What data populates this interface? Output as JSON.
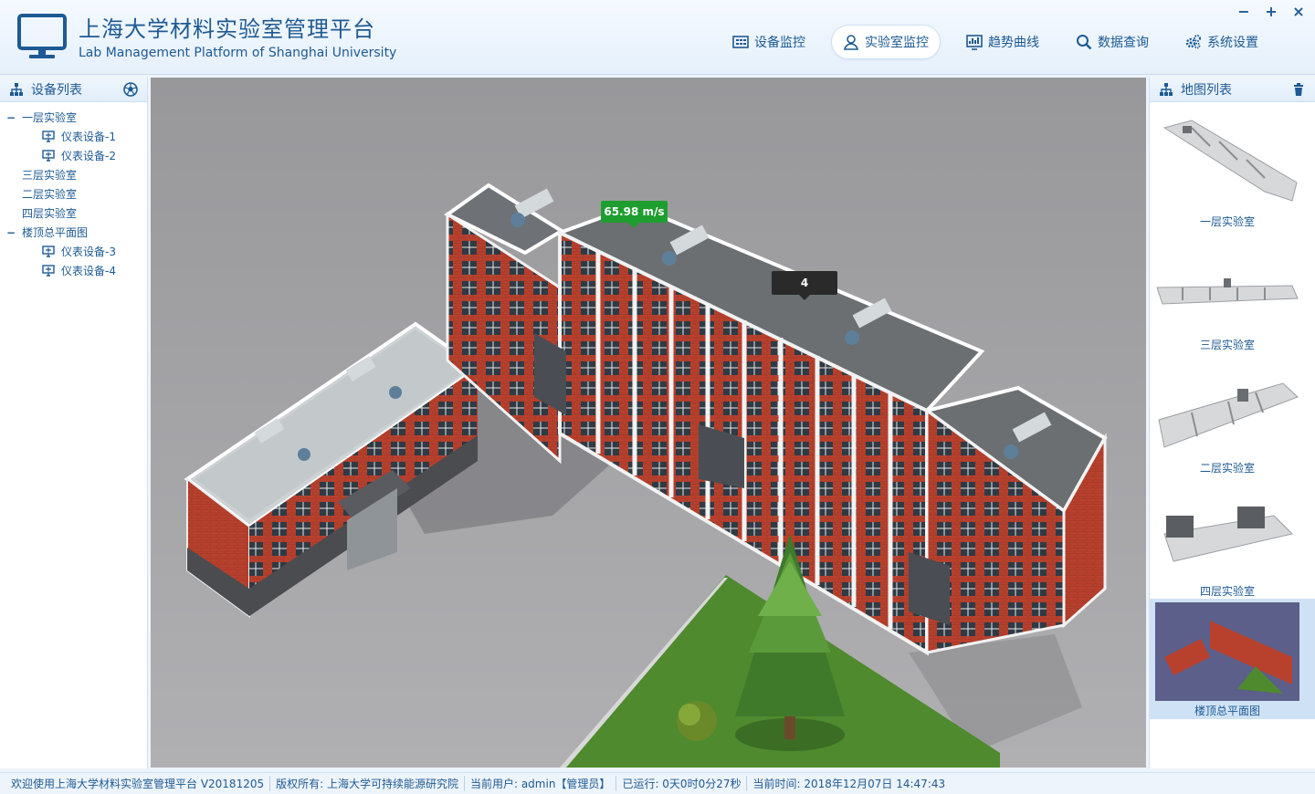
{
  "header": {
    "title": "上海大学材料实验室管理平台",
    "subtitle": "Lab Management Platform of Shanghai University",
    "logo_icon": "monitor-icon"
  },
  "nav": [
    {
      "label": "设备监控",
      "icon": "grid-icon",
      "active": false
    },
    {
      "label": "实验室监控",
      "icon": "user-location-icon",
      "active": true
    },
    {
      "label": "趋势曲线",
      "icon": "chart-icon",
      "active": false
    },
    {
      "label": "数据查询",
      "icon": "search-icon",
      "active": false
    },
    {
      "label": "系统设置",
      "icon": "gears-icon",
      "active": false
    }
  ],
  "window_controls": {
    "minimize": "−",
    "maximize": "+",
    "close": "×"
  },
  "left_panel": {
    "title": "设备列表",
    "tree": [
      {
        "label": "一层实验室",
        "toggle": "−",
        "children": [
          "仪表设备-1",
          "仪表设备-2"
        ]
      },
      {
        "label": "三层实验室"
      },
      {
        "label": "二层实验室"
      },
      {
        "label": "四层实验室"
      },
      {
        "label": "楼顶总平面图",
        "toggle": "−",
        "children": [
          "仪表设备-3",
          "仪表设备-4"
        ]
      }
    ]
  },
  "viewport": {
    "tag_speed": "65.98 m/s",
    "tag_num": "4",
    "colors": {
      "ground": "#a3a3a6",
      "brick": "#b8412e",
      "roof": "#6b6f72",
      "grass": "#4f8a2e"
    }
  },
  "right_panel": {
    "title": "地图列表",
    "maps": [
      {
        "label": "一层实验室"
      },
      {
        "label": "三层实验室"
      },
      {
        "label": "二层实验室"
      },
      {
        "label": "四层实验室"
      },
      {
        "label": "楼顶总平面图",
        "selected": true
      }
    ]
  },
  "statusbar": {
    "welcome": "欢迎使用上海大学材料实验室管理平台 V20181205",
    "copyright": "版权所有: 上海大学可持续能源研究院",
    "user": "当前用户: admin【管理员】",
    "uptime": "已运行: 0天0时0分27秒",
    "time": "当前时间: 2018年12月07日 14:47:43"
  }
}
